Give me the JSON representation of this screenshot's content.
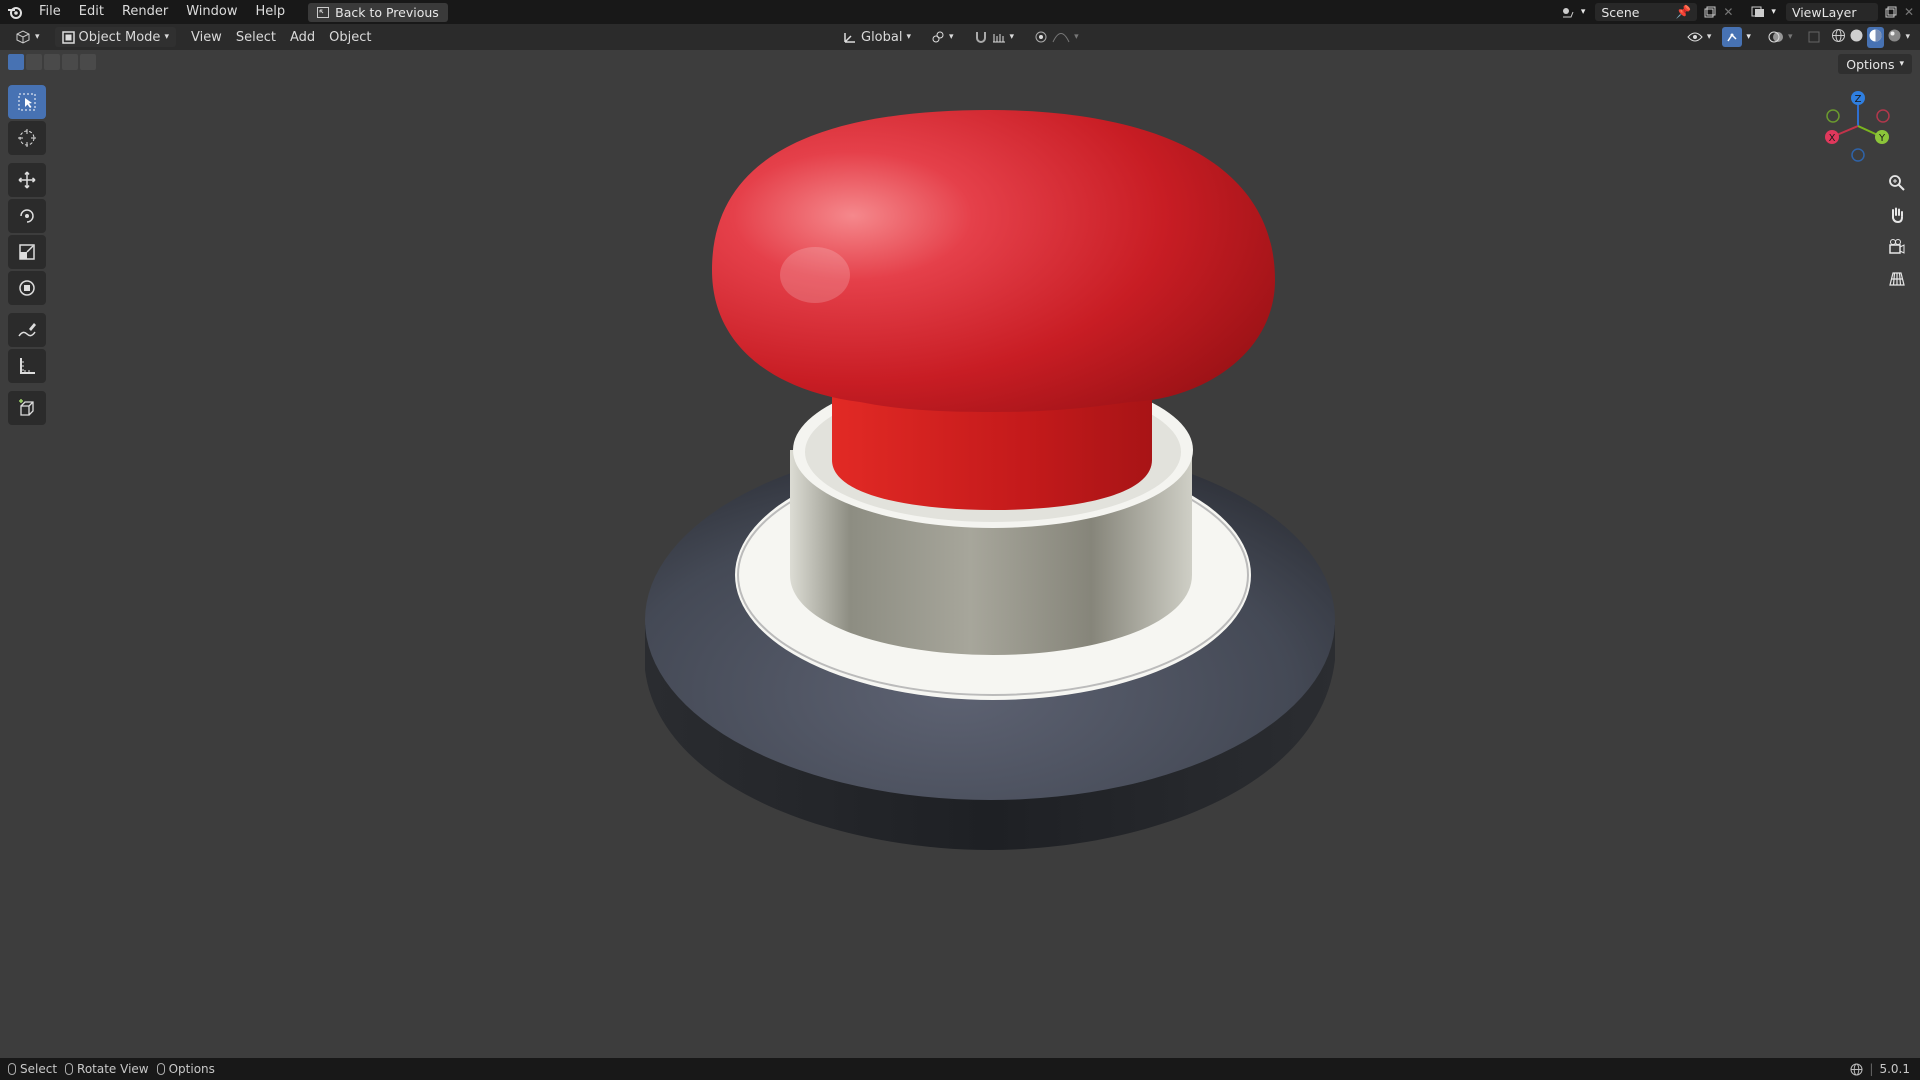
{
  "menu": [
    "File",
    "Edit",
    "Render",
    "Window",
    "Help"
  ],
  "back_button": "Back to Previous",
  "scene": {
    "name": "Scene",
    "view_layer": "ViewLayer"
  },
  "header": {
    "mode": "Object Mode",
    "menus": [
      "View",
      "Select",
      "Add",
      "Object"
    ],
    "transform_orientation": "Global"
  },
  "options_label": "Options",
  "gizmo": {
    "z": "Z",
    "x": "X",
    "y": "Y"
  },
  "status": {
    "hints": [
      "Select",
      "Rotate View",
      "Options"
    ],
    "version": "5.0.1"
  },
  "colors": {
    "accent": "#4772b3",
    "button_red": "#d21f24",
    "base_dark": "#3f4452"
  }
}
